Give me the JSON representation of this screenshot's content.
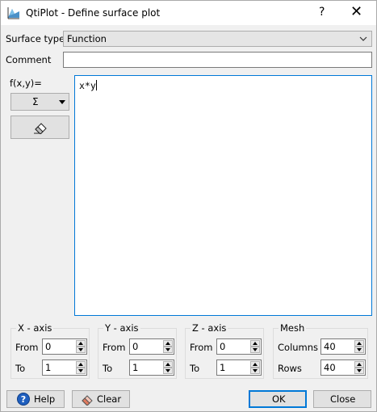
{
  "window": {
    "title": "QtiPlot - Define surface plot",
    "help_glyph": "?",
    "close_glyph": "✕"
  },
  "surface_type": {
    "label": "Surface type",
    "value": "Function"
  },
  "comment": {
    "label": "Comment",
    "value": ""
  },
  "function": {
    "label": "f(x,y)=",
    "sigma_label": "Σ",
    "expression": "x*y"
  },
  "x_axis": {
    "title": "X - axis",
    "from_label": "From",
    "from_value": "0",
    "to_label": "To",
    "to_value": "1"
  },
  "y_axis": {
    "title": "Y - axis",
    "from_label": "From",
    "from_value": "0",
    "to_label": "To",
    "to_value": "1"
  },
  "z_axis": {
    "title": "Z - axis",
    "from_label": "From",
    "from_value": "0",
    "to_label": "To",
    "to_value": "1"
  },
  "mesh": {
    "title": "Mesh",
    "columns_label": "Columns",
    "columns_value": "40",
    "rows_label": "Rows",
    "rows_value": "40"
  },
  "buttons": {
    "help": "Help",
    "clear": "Clear",
    "ok": "OK",
    "close": "Close"
  },
  "colors": {
    "accent": "#0078d7",
    "background": "#f0f0f0"
  }
}
